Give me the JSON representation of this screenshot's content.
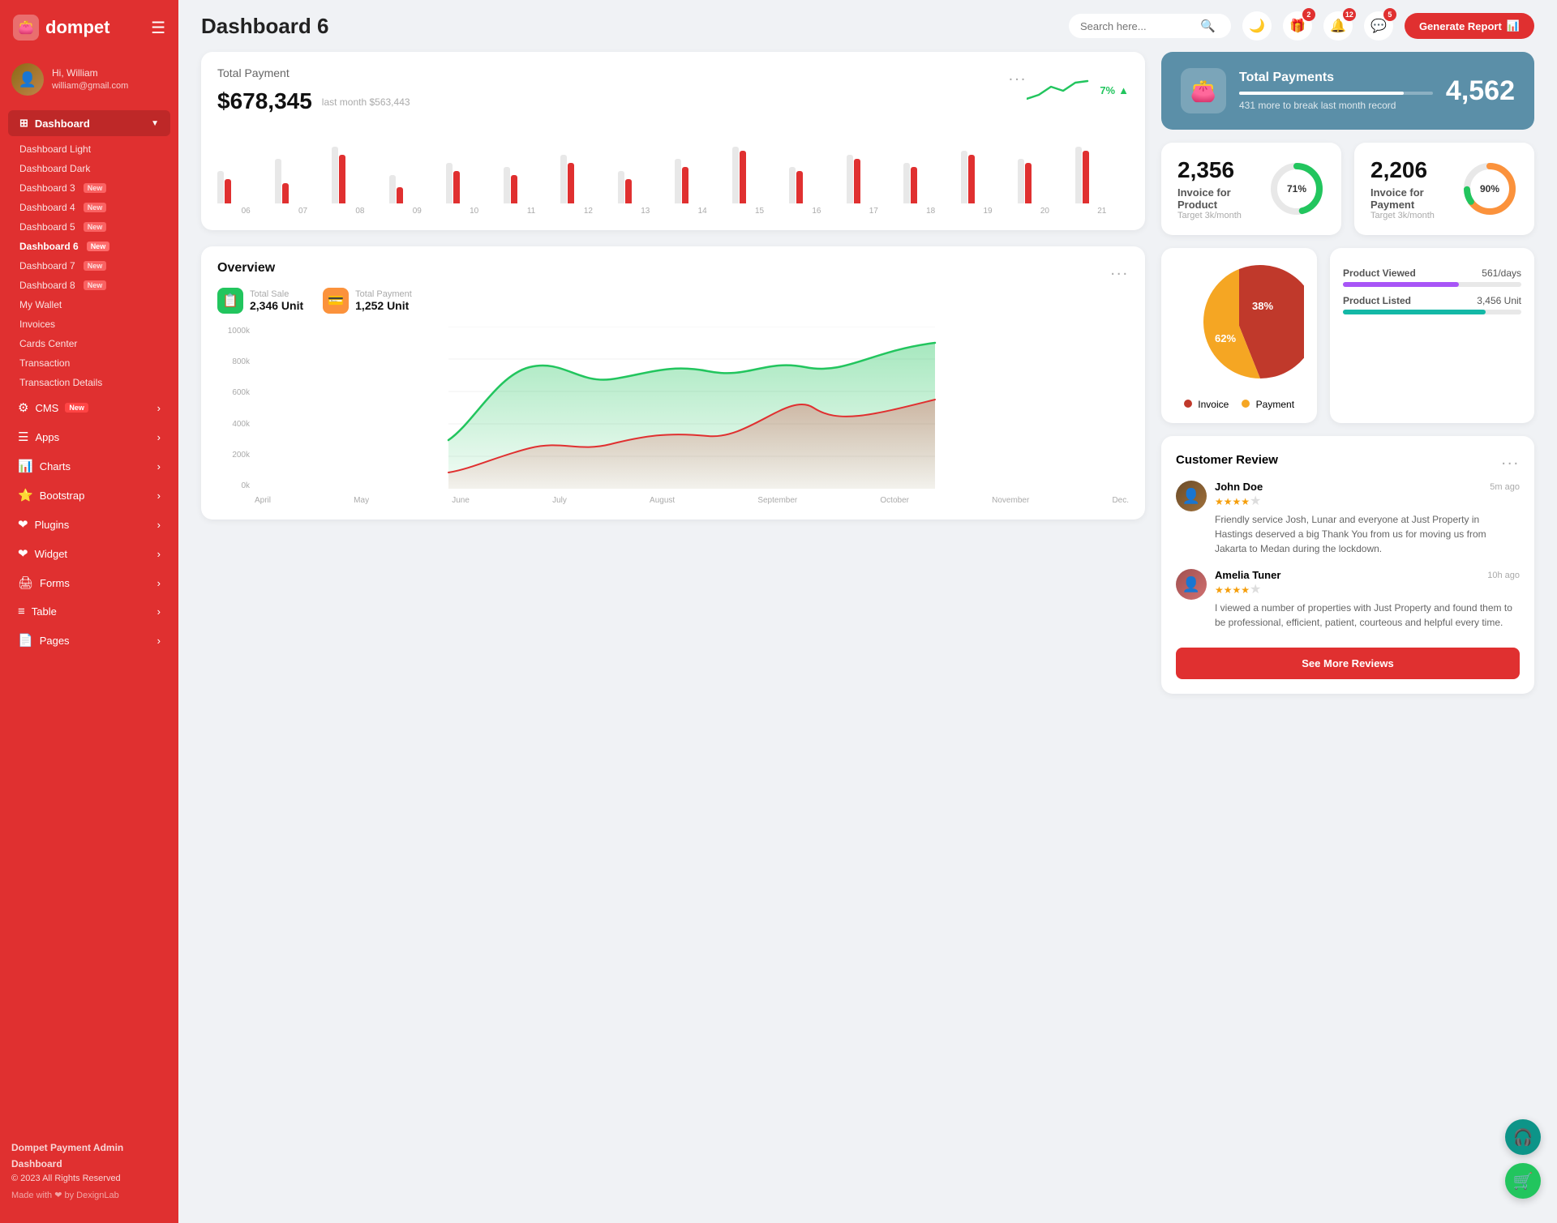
{
  "sidebar": {
    "logo": "dompet",
    "user": {
      "hi": "Hi, William",
      "name": "William",
      "email": "william@gmail.com"
    },
    "dashboard_section": "Dashboard",
    "nav_items": [
      {
        "id": "dashboard-light",
        "label": "Dashboard Light",
        "badge": null
      },
      {
        "id": "dashboard-dark",
        "label": "Dashboard Dark",
        "badge": null
      },
      {
        "id": "dashboard-3",
        "label": "Dashboard 3",
        "badge": "New"
      },
      {
        "id": "dashboard-4",
        "label": "Dashboard 4",
        "badge": "New"
      },
      {
        "id": "dashboard-5",
        "label": "Dashboard 5",
        "badge": "New"
      },
      {
        "id": "dashboard-6",
        "label": "Dashboard 6",
        "badge": "New"
      },
      {
        "id": "dashboard-7",
        "label": "Dashboard 7",
        "badge": "New"
      },
      {
        "id": "dashboard-8",
        "label": "Dashboard 8",
        "badge": "New"
      },
      {
        "id": "my-wallet",
        "label": "My Wallet",
        "badge": null
      },
      {
        "id": "invoices",
        "label": "Invoices",
        "badge": null
      },
      {
        "id": "cards-center",
        "label": "Cards Center",
        "badge": null
      },
      {
        "id": "transaction",
        "label": "Transaction",
        "badge": null
      },
      {
        "id": "transaction-details",
        "label": "Transaction Details",
        "badge": null
      }
    ],
    "menu_items": [
      {
        "id": "cms",
        "label": "CMS",
        "icon": "⚙",
        "badge": "New",
        "arrow": true
      },
      {
        "id": "apps",
        "label": "Apps",
        "icon": "☰",
        "badge": null,
        "arrow": true
      },
      {
        "id": "charts",
        "label": "Charts",
        "icon": "📊",
        "badge": null,
        "arrow": true
      },
      {
        "id": "bootstrap",
        "label": "Bootstrap",
        "icon": "⭐",
        "badge": null,
        "arrow": true
      },
      {
        "id": "plugins",
        "label": "Plugins",
        "icon": "❤",
        "badge": null,
        "arrow": true
      },
      {
        "id": "widget",
        "label": "Widget",
        "icon": "❤",
        "badge": null,
        "arrow": true
      },
      {
        "id": "forms",
        "label": "Forms",
        "icon": "🖨",
        "badge": null,
        "arrow": true
      },
      {
        "id": "table",
        "label": "Table",
        "icon": "≡",
        "badge": null,
        "arrow": true
      },
      {
        "id": "pages",
        "label": "Pages",
        "icon": "📄",
        "badge": null,
        "arrow": true
      }
    ],
    "footer": {
      "brand": "Dompet Payment Admin Dashboard",
      "copyright": "© 2023 All Rights Reserved",
      "made_with": "Made with ❤ by DexignLab"
    }
  },
  "topbar": {
    "page_title": "Dashboard 6",
    "search_placeholder": "Search here...",
    "notifications": [
      {
        "id": "gift",
        "count": "2"
      },
      {
        "id": "bell",
        "count": "12"
      },
      {
        "id": "chat",
        "count": "5"
      }
    ],
    "generate_btn": "Generate Report"
  },
  "total_payment": {
    "title": "Total Payment",
    "amount": "$678,345",
    "last_month_label": "last month $563,443",
    "trend_pct": "7%",
    "dots": "...",
    "bars": [
      {
        "gray": 40,
        "red": 30
      },
      {
        "gray": 55,
        "red": 25
      },
      {
        "gray": 70,
        "red": 60
      },
      {
        "gray": 35,
        "red": 20
      },
      {
        "gray": 50,
        "red": 40
      },
      {
        "gray": 45,
        "red": 35
      },
      {
        "gray": 60,
        "red": 50
      },
      {
        "gray": 40,
        "red": 30
      },
      {
        "gray": 55,
        "red": 45
      },
      {
        "gray": 70,
        "red": 65
      },
      {
        "gray": 45,
        "red": 40
      },
      {
        "gray": 60,
        "red": 55
      },
      {
        "gray": 50,
        "red": 45
      },
      {
        "gray": 65,
        "red": 60
      },
      {
        "gray": 55,
        "red": 50
      },
      {
        "gray": 70,
        "red": 65
      }
    ],
    "bar_labels": [
      "06",
      "07",
      "08",
      "09",
      "10",
      "11",
      "12",
      "13",
      "14",
      "15",
      "16",
      "17",
      "18",
      "19",
      "20",
      "21"
    ]
  },
  "blue_card": {
    "icon": "👛",
    "title": "Total Payments",
    "subtitle": "431 more to break last month record",
    "value": "4,562",
    "progress": 85
  },
  "invoice_product": {
    "amount": "2,356",
    "label": "Invoice for Product",
    "target": "Target 3k/month",
    "percent": 71,
    "color": "#22c55e"
  },
  "invoice_payment": {
    "amount": "2,206",
    "label": "Invoice for Payment",
    "target": "Target 3k/month",
    "percent": 90,
    "color": "#fb923c"
  },
  "overview": {
    "title": "Overview",
    "dots": "...",
    "total_sale_label": "Total Sale",
    "total_sale_value": "2,346 Unit",
    "total_payment_label": "Total Payment",
    "total_payment_value": "1,252 Unit",
    "y_labels": [
      "1000k",
      "800k",
      "600k",
      "400k",
      "200k",
      "0k"
    ],
    "x_labels": [
      "April",
      "May",
      "June",
      "July",
      "August",
      "September",
      "October",
      "November",
      "Dec."
    ]
  },
  "pie_chart": {
    "invoice_pct": "62%",
    "payment_pct": "38%",
    "invoice_label": "Invoice",
    "payment_label": "Payment",
    "invoice_color": "#c0392b",
    "payment_color": "#f5a623"
  },
  "product_stats": [
    {
      "label": "Product Viewed",
      "value": "561/days",
      "bar_color": "#a855f7",
      "pct": 65
    },
    {
      "label": "Product Listed",
      "value": "3,456 Unit",
      "bar_color": "#14b8a6",
      "pct": 80
    }
  ],
  "customer_review": {
    "title": "Customer Review",
    "dots": "...",
    "reviews": [
      {
        "name": "John Doe",
        "stars": 4,
        "time": "5m ago",
        "text": "Friendly service Josh, Lunar and everyone at Just Property in Hastings deserved a big Thank You from us for moving us from Jakarta to Medan during the lockdown.",
        "gender": "male"
      },
      {
        "name": "Amelia Tuner",
        "stars": 4,
        "time": "10h ago",
        "text": "I viewed a number of properties with Just Property and found them to be professional, efficient, patient, courteous and helpful every time.",
        "gender": "female"
      }
    ],
    "see_more_btn": "See More Reviews"
  },
  "floating": {
    "support_icon": "🎧",
    "cart_icon": "🛒"
  }
}
